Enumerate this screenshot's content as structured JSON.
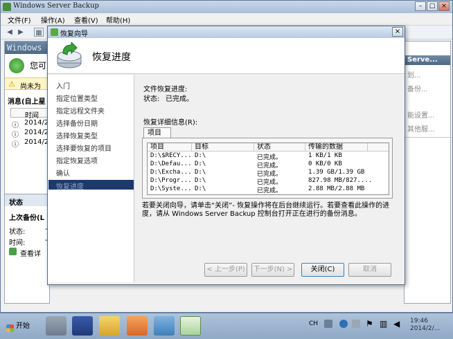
{
  "main_window": {
    "title": "Windows Server Backup",
    "menu": [
      "文件(F)",
      "操作(A)",
      "查看(V)",
      "帮助(H)"
    ],
    "left_header": "Windows",
    "left_welcome": "您可",
    "left_warning": "尚未为",
    "left_messages_title": "消息(自上星",
    "left_messages_col": "时间",
    "left_messages_rows": [
      "2014/2/",
      "2014/2/",
      "2014/2/"
    ],
    "left_status_header": "状态",
    "left_last_backup": "上次备份(L",
    "left_status_label": "状态:",
    "left_status_value": "-",
    "left_time_label": "时间:",
    "left_time_value": "-",
    "left_view_details": "查看详",
    "right_pane_items": [
      "Serve...",
      "划...",
      "备份...",
      "能设置...",
      "其他服..."
    ]
  },
  "dialog": {
    "title": "恢复向导",
    "close_label": "×",
    "header_title": "恢复进度",
    "nav": [
      "入门",
      "指定位置类型",
      "指定远程文件夹",
      "选择备份日期",
      "选择恢复类型",
      "选择要恢复的项目",
      "指定恢复选项",
      "确认",
      "恢复进度"
    ],
    "file_progress_label": "文件恢复进度:",
    "status_label": "状态:",
    "status_value": "已完成。",
    "details_label": "恢复详细信息(R):",
    "tab_label": "项目",
    "columns": [
      "项目",
      "目标",
      "状态",
      "传输的数据"
    ],
    "rows": [
      [
        "D:\\$RECY...",
        "D:\\",
        "已完成。",
        "1 KB/1 KB"
      ],
      [
        "D:\\Defau...",
        "D:\\",
        "已完成。",
        "0 KB/0 KB"
      ],
      [
        "D:\\Excha...",
        "D:\\",
        "已完成。",
        "1.39 GB/1.39 GB"
      ],
      [
        "D:\\Progr...",
        "D:\\",
        "已完成。",
        "827.98 MB/827...."
      ],
      [
        "D:\\Syste...",
        "D:\\",
        "已完成。",
        "2.88 MB/2.88 MB"
      ]
    ],
    "note_line1": "若要关闭向导，请单击“关闭”- 恢复操作将在后台继续运行。若要查看此操作的进",
    "note_line2": "度，请从 Windows Server Backup 控制台打开正在进行的备份消息。",
    "buttons": {
      "prev": "< 上一步(P)",
      "next": "下一步(N) >",
      "close": "关闭(C)",
      "cancel": "取消"
    }
  },
  "taskbar": {
    "start": "开始",
    "tray_lang": "CH",
    "tray_time": "19:46",
    "tray_date": "2014/2/..."
  },
  "colors": {
    "titlebar": "#b7cbe2",
    "nav_selected": "#1c3a6e",
    "taskbar": "#9fb6d0"
  }
}
